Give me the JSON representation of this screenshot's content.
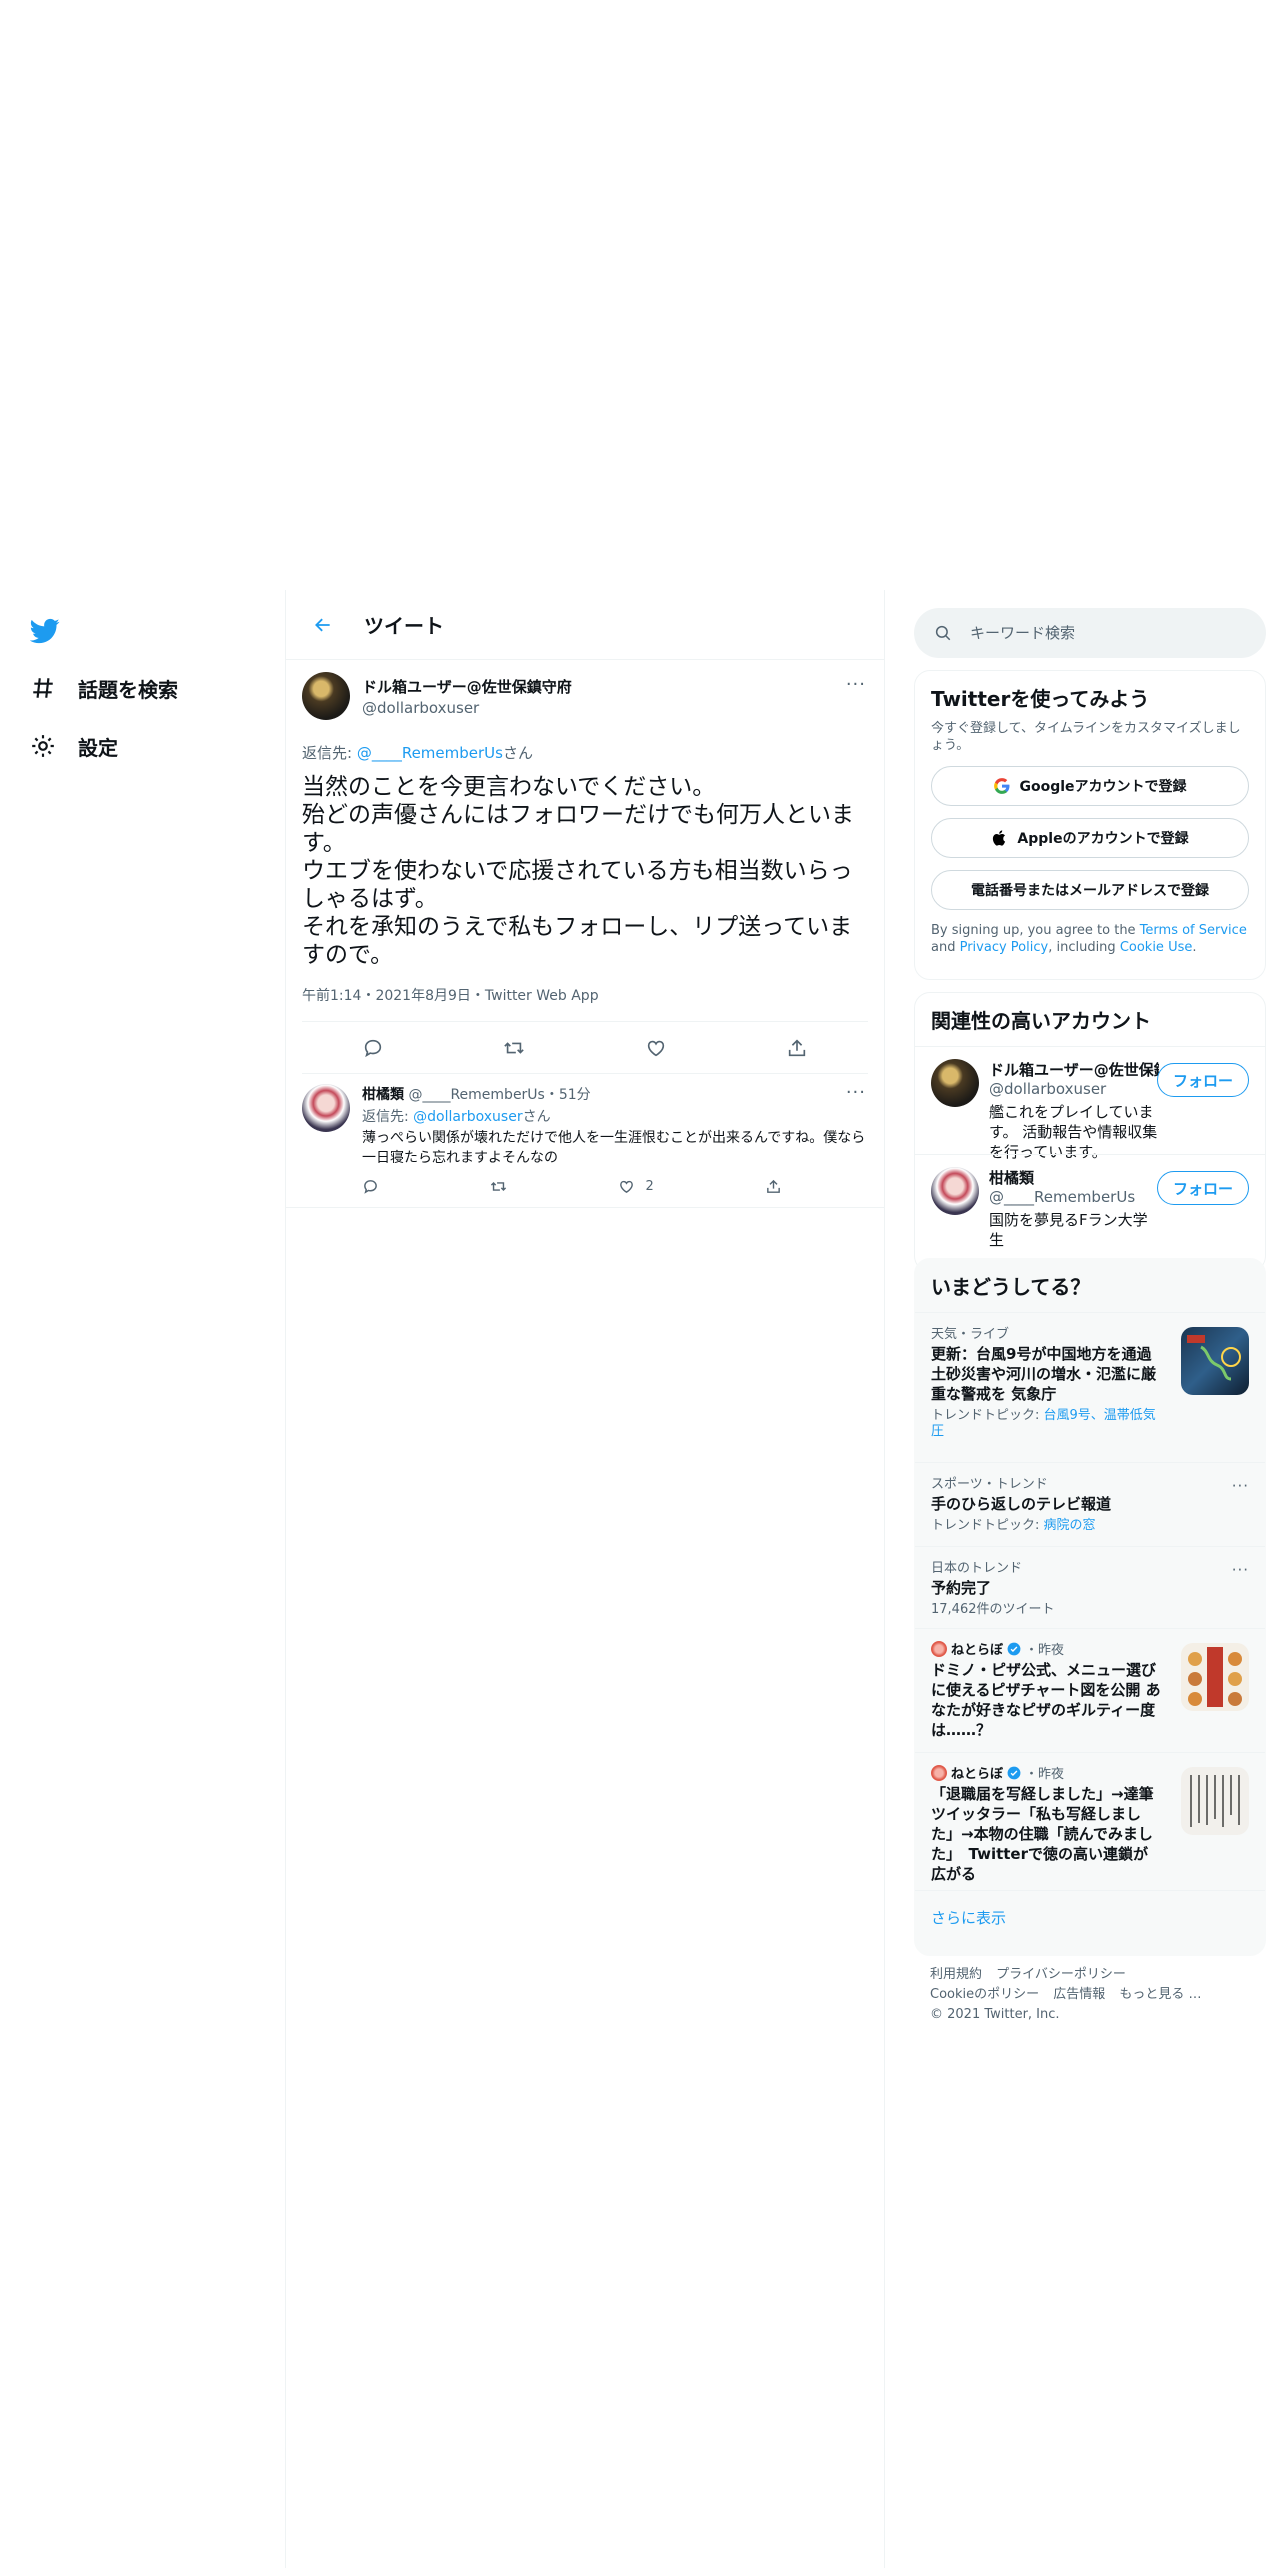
{
  "leftnav": {
    "explore_label": "話題を検索",
    "settings_label": "設定"
  },
  "header": {
    "title": "ツイート"
  },
  "main_tweet": {
    "name": "ドル箱ユーザー@佐世保鎮守府",
    "handle": "@dollarboxuser",
    "reply_prefix": "返信先: ",
    "reply_handle": "@____RememberUs",
    "reply_suffix": "さん",
    "text": "当然のことを今更言わないでください。\n殆どの声優さんにはフォロワーだけでも何万人といます。\nウエブを使わないで応援されている方も相当数いらっしゃるはず。\nそれを承知のうえで私もフォローし、リプ送っていますので。",
    "meta": "午前1:14・2021年8月9日・Twitter Web App"
  },
  "reply_tweet": {
    "name": "柑橘類",
    "handle_time": "@____RememberUs・51分",
    "reply_prefix": "返信先: ",
    "reply_handle": "@dollarboxuser",
    "reply_suffix": "さん",
    "text": "薄っぺらい関係が壊れただけで他人を一生涯恨むことが出来るんですね。僕なら一日寝たら忘れますよそんなの",
    "like_count": "2"
  },
  "search": {
    "placeholder": "キーワード検索"
  },
  "signup": {
    "title": "Twitterを使ってみよう",
    "subtitle": "今すぐ登録して、タイムラインをカスタマイズしましょう。",
    "google_label": "Googleアカウントで登録",
    "apple_label": "Appleのアカウントで登録",
    "phone_label": "電話番号またはメールアドレスで登録",
    "terms_1": "By signing up, you agree to the ",
    "terms_tos": "Terms of Service",
    "terms_2": " and ",
    "terms_privacy": "Privacy Policy",
    "terms_3": ", including ",
    "terms_cookie": "Cookie Use",
    "terms_4": "."
  },
  "related": {
    "title": "関連性の高いアカウント",
    "accounts": [
      {
        "name": "ドル箱ユーザー@佐世保鎮守府",
        "handle": "@dollarboxuser",
        "bio": "艦これをプレイしています。 活動報告や情報収集を行っています。",
        "follow": "フォロー"
      },
      {
        "name": "柑橘類",
        "handle": "@____RememberUs",
        "bio": "国防を夢見るFラン大学生",
        "follow": "フォロー"
      }
    ]
  },
  "trends": {
    "title": "いまどうしてる？",
    "items": [
      {
        "meta": "天気・ライブ",
        "title": "更新：台風9号が中国地方を通過 土砂災害や河川の増水・氾濫に厳重な警戒を 気象庁",
        "sub_prefix": "トレンドトピック: ",
        "sub_link": "台風9号、温帯低気圧"
      },
      {
        "meta": "スポーツ・トレンド",
        "title": "手のひら返しのテレビ報道",
        "sub_prefix": "トレンドトピック: ",
        "sub_link": "病院の窓"
      },
      {
        "meta": "日本のトレンド",
        "title": "予約完了",
        "sub": "17,462件のツイート"
      },
      {
        "source": "ねとらぼ",
        "time": "・昨夜",
        "title": "ドミノ・ピザ公式、メニュー選びに使えるピザチャート図を公開 あなたが好きなピザのギルティー度は……？"
      },
      {
        "source": "ねとらぼ",
        "time": "・昨夜",
        "title": "「退職届を写経しました」→達筆ツイッタラー「私も写経しました」→本物の住職「読んでみました」　Twitterで徳の高い連鎖が広がる"
      }
    ],
    "show_more": "さらに表示"
  },
  "footer": {
    "terms": "利用規約",
    "privacy": "プライバシーポリシー",
    "cookie": "Cookieのポリシー",
    "ads": "広告情報",
    "more": "もっと見る …",
    "copyright": "© 2021 Twitter, Inc."
  },
  "colors": {
    "accent": "#1d9bf0",
    "text": "#0f1419",
    "secondary": "#536471",
    "border": "#eff3f4"
  }
}
